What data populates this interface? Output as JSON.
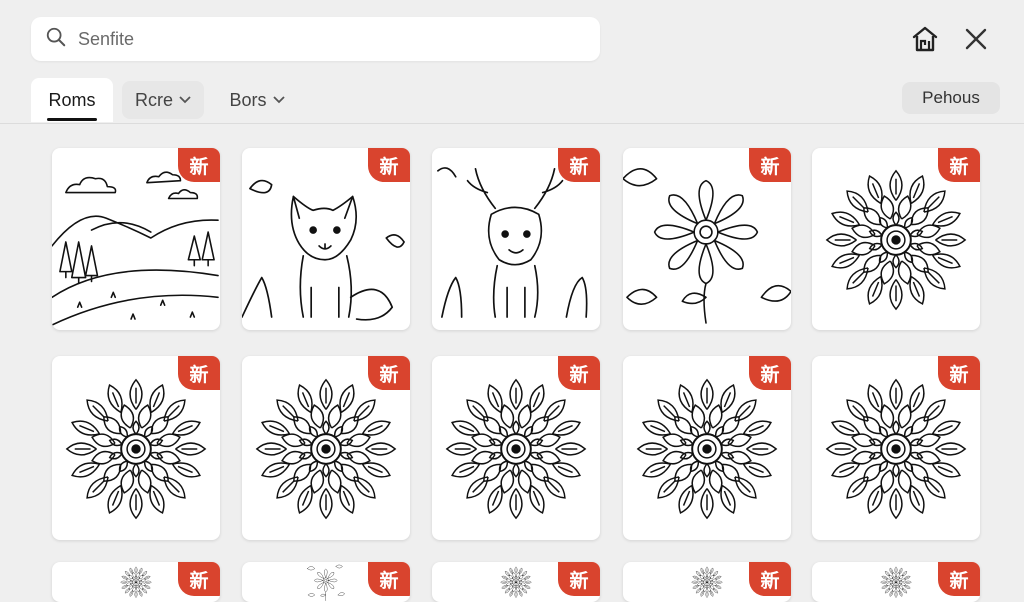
{
  "search": {
    "placeholder": "Senfite",
    "icon": "search-icon"
  },
  "top_actions": {
    "home": "home-icon",
    "close": "close-icon"
  },
  "tabs": [
    {
      "label": "Roms",
      "active": true,
      "dropdown": false
    },
    {
      "label": "Rcre",
      "active": false,
      "dropdown": true
    },
    {
      "label": "Bors",
      "active": false,
      "dropdown": true
    }
  ],
  "right_button": {
    "label": "Pehous"
  },
  "badge_text": "新",
  "cards": [
    {
      "art": "landscape"
    },
    {
      "art": "fox"
    },
    {
      "art": "deer"
    },
    {
      "art": "flower"
    },
    {
      "art": "mandala"
    },
    {
      "art": "mandala"
    },
    {
      "art": "mandala"
    },
    {
      "art": "mandala"
    },
    {
      "art": "mandala"
    },
    {
      "art": "mandala"
    },
    {
      "art": "mandala"
    },
    {
      "art": "flower"
    },
    {
      "art": "mandala"
    },
    {
      "art": "mandala"
    },
    {
      "art": "mandala"
    }
  ]
}
